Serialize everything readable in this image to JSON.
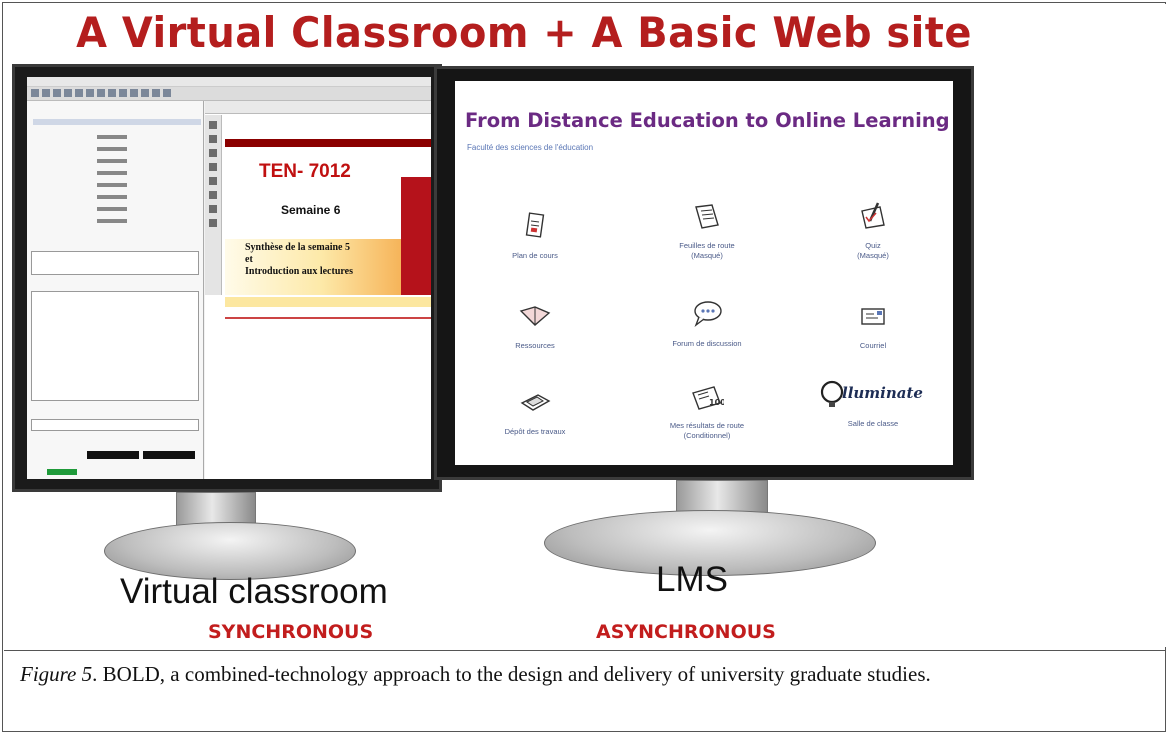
{
  "figure": {
    "headline": "A Virtual Classroom + A Basic Web site",
    "virtual_classroom": {
      "label": "Virtual classroom",
      "mode": "SYNCHRONOUS",
      "slide": {
        "code": "TEN- 7012",
        "week": "Semaine 6",
        "body_line1": "Synthèse de la semaine 5",
        "body_line2": "et",
        "body_line3": "Introduction aux lectures"
      }
    },
    "lms": {
      "label": "LMS",
      "mode": "ASYNCHRONOUS",
      "title": "From Distance Education to Online Learning",
      "subtitle": "Faculté des sciences de l'éducation",
      "tiles": [
        {
          "label": "Plan de cours",
          "icon": "document-icon"
        },
        {
          "label": "Feuilles de route\n(Masqué)",
          "icon": "scroll-icon"
        },
        {
          "label": "Quiz\n(Masqué)",
          "icon": "quiz-pencil-icon"
        },
        {
          "label": "Ressources",
          "icon": "open-book-icon"
        },
        {
          "label": "Forum de discussion",
          "icon": "speech-bubble-icon"
        },
        {
          "label": "Courriel",
          "icon": "mail-icon"
        },
        {
          "label": "Dépôt des travaux",
          "icon": "tray-icon"
        },
        {
          "label": "Mes résultats de route\n(Conditionnel)",
          "icon": "grade-icon"
        },
        {
          "label": "Salle de classe",
          "icon": "illuminate-logo-icon"
        }
      ]
    }
  },
  "caption": {
    "label": "Figure 5",
    "text": ". BOLD, a combined-technology approach to the design and delivery of university graduate studies."
  }
}
